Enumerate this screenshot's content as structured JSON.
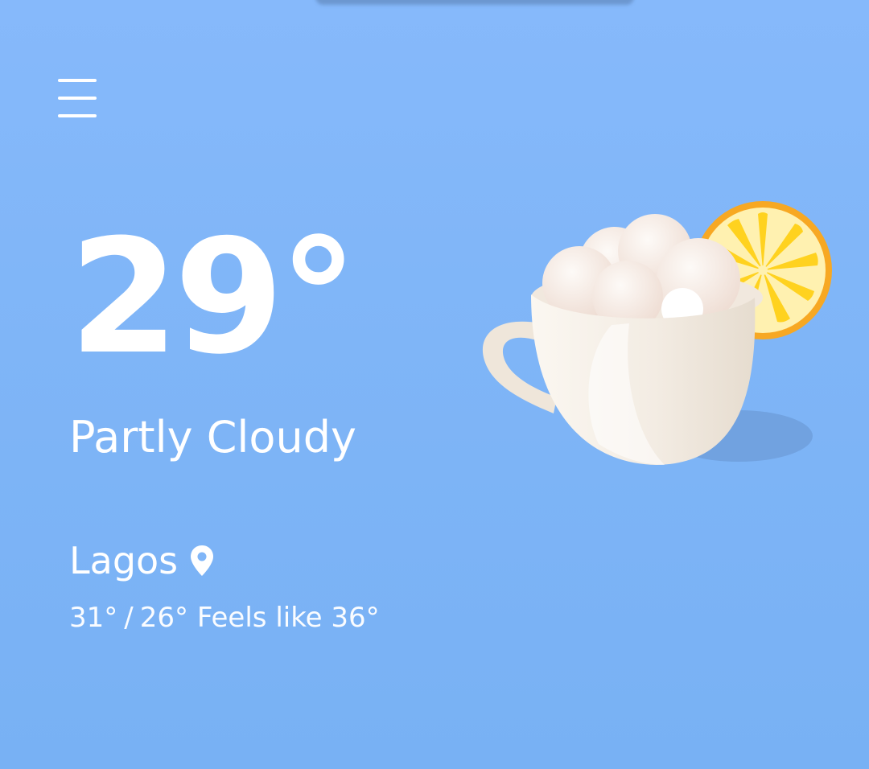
{
  "weather": {
    "temperature": "29°",
    "condition": "Partly Cloudy",
    "location": "Lagos",
    "high": "31°",
    "separator": "/",
    "low": "26°",
    "feels_like_label": "Feels like",
    "feels_like": "36°"
  },
  "icons": {
    "menu": "hamburger-menu-icon",
    "location": "location-pin-icon",
    "illustration": "teacup-cloud-lemon-illustration"
  },
  "colors": {
    "background": "#80b6f8",
    "text": "#ffffff",
    "lemon": "#ffd21f",
    "lemon_rind": "#f7a823"
  }
}
